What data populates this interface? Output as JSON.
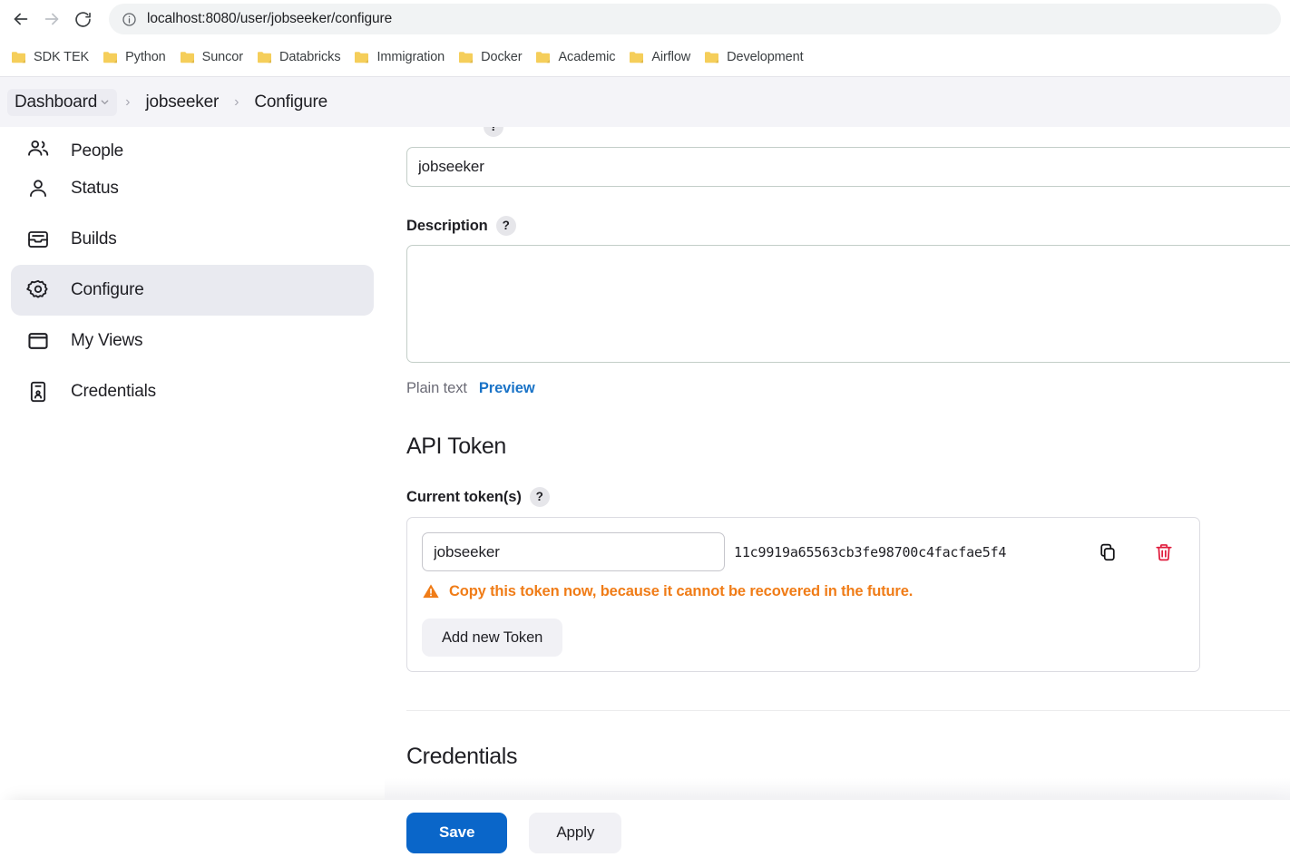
{
  "browser": {
    "back_icon": "back-arrow-icon",
    "forward_icon": "forward-arrow-icon",
    "reload_icon": "reload-icon",
    "site_info_icon": "site-info-icon",
    "url": "localhost:8080/user/jobseeker/configure",
    "bookmarks": [
      {
        "label": "SDK TEK"
      },
      {
        "label": "Python"
      },
      {
        "label": "Suncor"
      },
      {
        "label": "Databricks"
      },
      {
        "label": "Immigration"
      },
      {
        "label": "Docker"
      },
      {
        "label": "Academic"
      },
      {
        "label": "Airflow"
      },
      {
        "label": "Development"
      }
    ]
  },
  "breadcrumb": {
    "items": [
      {
        "label": "Dashboard",
        "has_caret": true
      },
      {
        "label": "jobseeker",
        "has_caret": false
      },
      {
        "label": "Configure",
        "has_caret": false
      }
    ],
    "separator": "›"
  },
  "sidebar": {
    "items": [
      {
        "label": "People",
        "icon": "people-icon",
        "active": false
      },
      {
        "label": "Status",
        "icon": "person-icon",
        "active": false
      },
      {
        "label": "Builds",
        "icon": "builds-icon",
        "active": false
      },
      {
        "label": "Configure",
        "icon": "gear-icon",
        "active": true
      },
      {
        "label": "My Views",
        "icon": "window-icon",
        "active": false
      },
      {
        "label": "Credentials",
        "icon": "id-card-icon",
        "active": false
      }
    ]
  },
  "form": {
    "full_name_value": "jobseeker",
    "full_name_placeholder": "",
    "description_label": "Description",
    "description_value": "",
    "description_placeholder": "",
    "help_glyph": "?",
    "editor": {
      "plain_text_label": "Plain text",
      "preview_label": "Preview"
    }
  },
  "api_token": {
    "section_title": "API Token",
    "current_tokens_label": "Current token(s)",
    "token_name_value": "jobseeker",
    "token_name_placeholder": "",
    "token_hash": "11c9919a65563cb3fe98700c4facfae5f4",
    "copy_icon": "copy-icon",
    "delete_icon": "trash-icon",
    "warning_icon": "warning-triangle-icon",
    "warning_text": "Copy this token now, because it cannot be recovered in the future.",
    "add_token_label": "Add new Token"
  },
  "credentials": {
    "section_title": "Credentials"
  },
  "actions": {
    "save_label": "Save",
    "apply_label": "Apply"
  },
  "colors": {
    "accent_blue": "#0a66c9",
    "link_blue": "#1a73c7",
    "warning_orange": "#f07c17",
    "danger_red": "#e01b3c",
    "active_nav_bg": "#e9eaf0",
    "breadcrumb_bg": "#f4f4f8"
  }
}
